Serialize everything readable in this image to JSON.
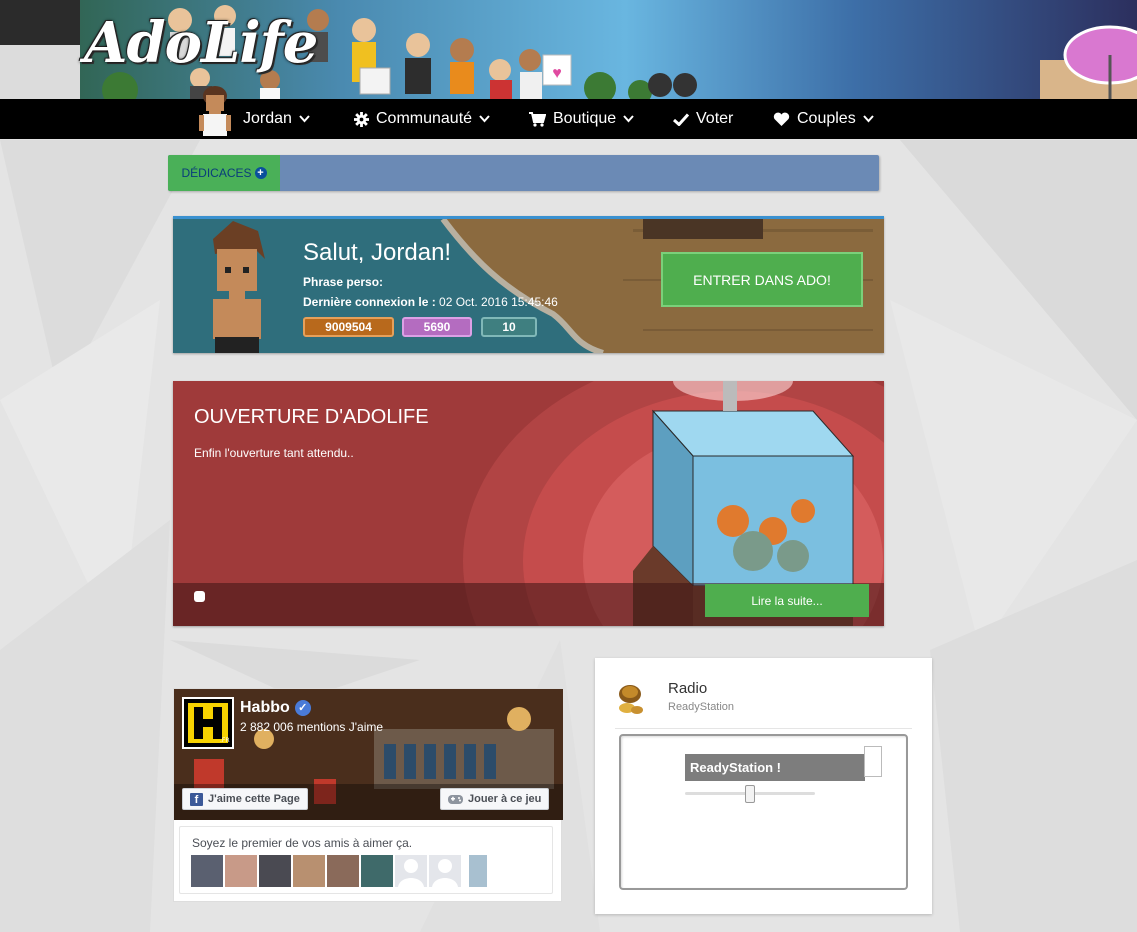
{
  "site": {
    "logo_text": "AdoLife"
  },
  "nav": {
    "user": "Jordan",
    "community": "Communauté",
    "shop": "Boutique",
    "vote": "Voter",
    "couples": "Couples"
  },
  "dedicaces": {
    "label": "DÉDICACES"
  },
  "welcome": {
    "greeting": "Salut, Jordan!",
    "motto_label": "Phrase perso:",
    "motto_value": "",
    "last_login_label": "Dernière connexion le :",
    "last_login_value": " 02 Oct. 2016 15:45:46",
    "stat_credits": "9009504",
    "stat_duckets": "5690",
    "stat_diamonds": "10",
    "enter_button": "ENTRER DANS ADO!"
  },
  "news": {
    "title": "OUVERTURE D'ADOLIFE",
    "description": "Enfin l'ouverture tant attendu..",
    "read_more": "Lire la suite..."
  },
  "facebook": {
    "page_name": "Habbo",
    "likes": "2 882 006 mentions J'aime",
    "like_button": "J'aime cette Page",
    "play_button": "Jouer à ce jeu",
    "friends_text": "Soyez le premier de vos amis à aimer ça."
  },
  "radio": {
    "title": "Radio",
    "subtitle": "ReadyStation",
    "player_title": "ReadyStation !"
  },
  "colors": {
    "nav_bg": "#000000",
    "accent_green": "#4fae4e",
    "dedicaces_bar": "#6b8ab5",
    "news_red": "#b74646",
    "stat_credits": "#b8691c",
    "stat_duckets": "#b46cc0",
    "stat_diamonds": "#4a8a8a"
  }
}
